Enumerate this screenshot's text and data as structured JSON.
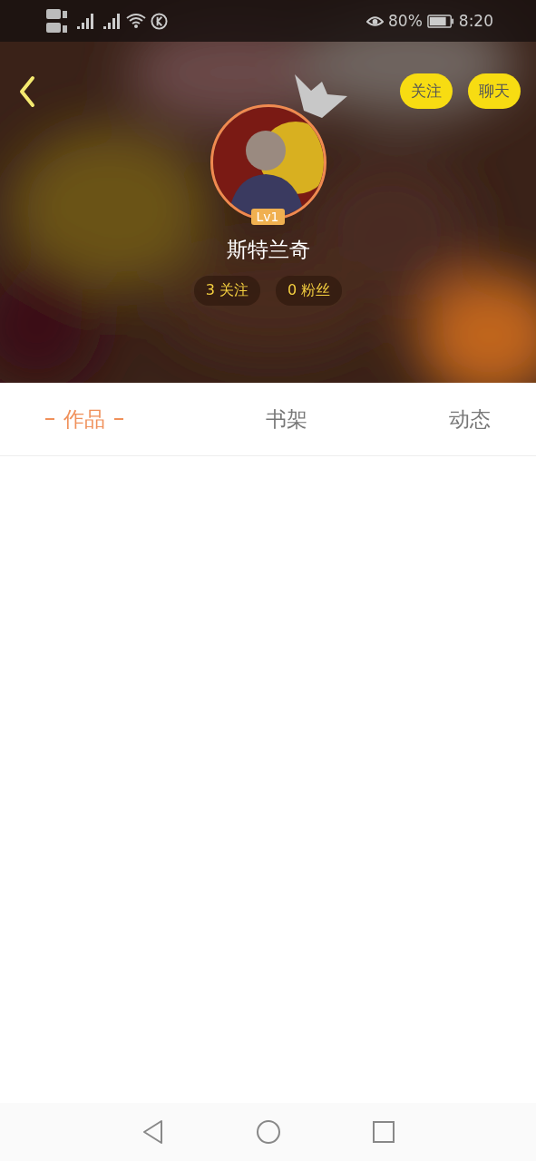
{
  "status_bar": {
    "battery": "80%",
    "time": "8:20"
  },
  "profile": {
    "actions": [
      {
        "label": "关注"
      },
      {
        "label": "聊天"
      }
    ],
    "level": "Lv1",
    "name": "斯特兰奇",
    "stats": [
      "3 关注",
      "0 粉丝"
    ]
  },
  "tabs": [
    {
      "label": "作品",
      "selected": true
    },
    {
      "label": "书架",
      "selected": false
    },
    {
      "label": "动态",
      "selected": false
    }
  ]
}
